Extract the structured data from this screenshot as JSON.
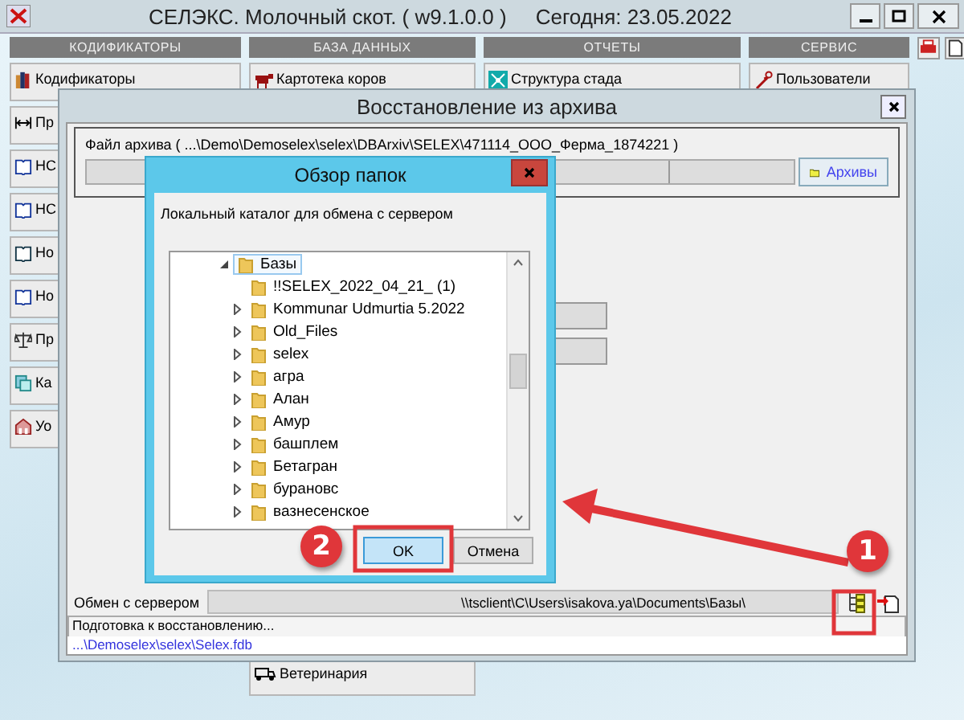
{
  "app": {
    "title": "СЕЛЭКС. Молочный скот. ( w9.1.0.0 )",
    "today": "Сегодня: 23.05.2022",
    "sections": [
      {
        "header": "КОДИФИКАТОРЫ",
        "items": [
          "Кодификаторы",
          "Пр",
          "НС",
          "НС",
          "Но",
          "Но",
          "Пр",
          "Ка",
          "Уо"
        ]
      },
      {
        "header": "БАЗА ДАННЫХ",
        "items": [
          "Картотека коров",
          "Ветеринария"
        ]
      },
      {
        "header": "ОТЧЕТЫ",
        "items": [
          "Структура стада"
        ]
      },
      {
        "header": "СЕРВИС",
        "items": [
          "Пользователи"
        ]
      }
    ]
  },
  "restore_dialog": {
    "title": "Восстановление из архива",
    "archive_file": "Файл архива ( ...\\Demo\\Demoselex\\selex\\DBArxiv\\SELEX\\471114_ООО_Ферма_1874221 )",
    "archives_button": "Архивы",
    "server_exchange": {
      "label": "Обмен с сервером",
      "value": "\\\\tsclient\\C\\Users\\isakova.ya\\Documents\\Базы\\"
    },
    "status": "Подготовка к восстановлению...",
    "db_path": "...\\Demoselex\\selex\\Selex.fdb"
  },
  "folder_dialog": {
    "title": "Обзор папок",
    "description": "Локальный каталог для обмена с сервером",
    "tree": [
      {
        "label": "Базы",
        "expandable": true,
        "expanded": true,
        "selected": true,
        "children": [
          {
            "label": "!!SELEX_2022_04_21_ (1)",
            "expandable": false,
            "selected": false
          },
          {
            "label": "Kommunar Udmurtia 5.2022",
            "expandable": true,
            "expanded": false,
            "selected": false
          },
          {
            "label": "Old_Files",
            "expandable": true,
            "expanded": false,
            "selected": false
          },
          {
            "label": "selex",
            "expandable": true,
            "expanded": false,
            "selected": false
          },
          {
            "label": "агра",
            "expandable": true,
            "expanded": false,
            "selected": false
          },
          {
            "label": "Алан",
            "expandable": true,
            "expanded": false,
            "selected": false
          },
          {
            "label": "Амур",
            "expandable": true,
            "expanded": false,
            "selected": false
          },
          {
            "label": "башплем",
            "expandable": true,
            "expanded": false,
            "selected": false
          },
          {
            "label": "Бетагран",
            "expandable": true,
            "expanded": false,
            "selected": false
          },
          {
            "label": "бурановс",
            "expandable": true,
            "expanded": false,
            "selected": false
          },
          {
            "label": "вазнесенское",
            "expandable": true,
            "expanded": false,
            "selected": false
          }
        ]
      }
    ],
    "buttons": [
      {
        "label": "OK",
        "default": true
      },
      {
        "label": "Отмена",
        "default": false
      }
    ]
  },
  "annotations": [
    {
      "label": "2"
    },
    {
      "label": "1"
    }
  ]
}
